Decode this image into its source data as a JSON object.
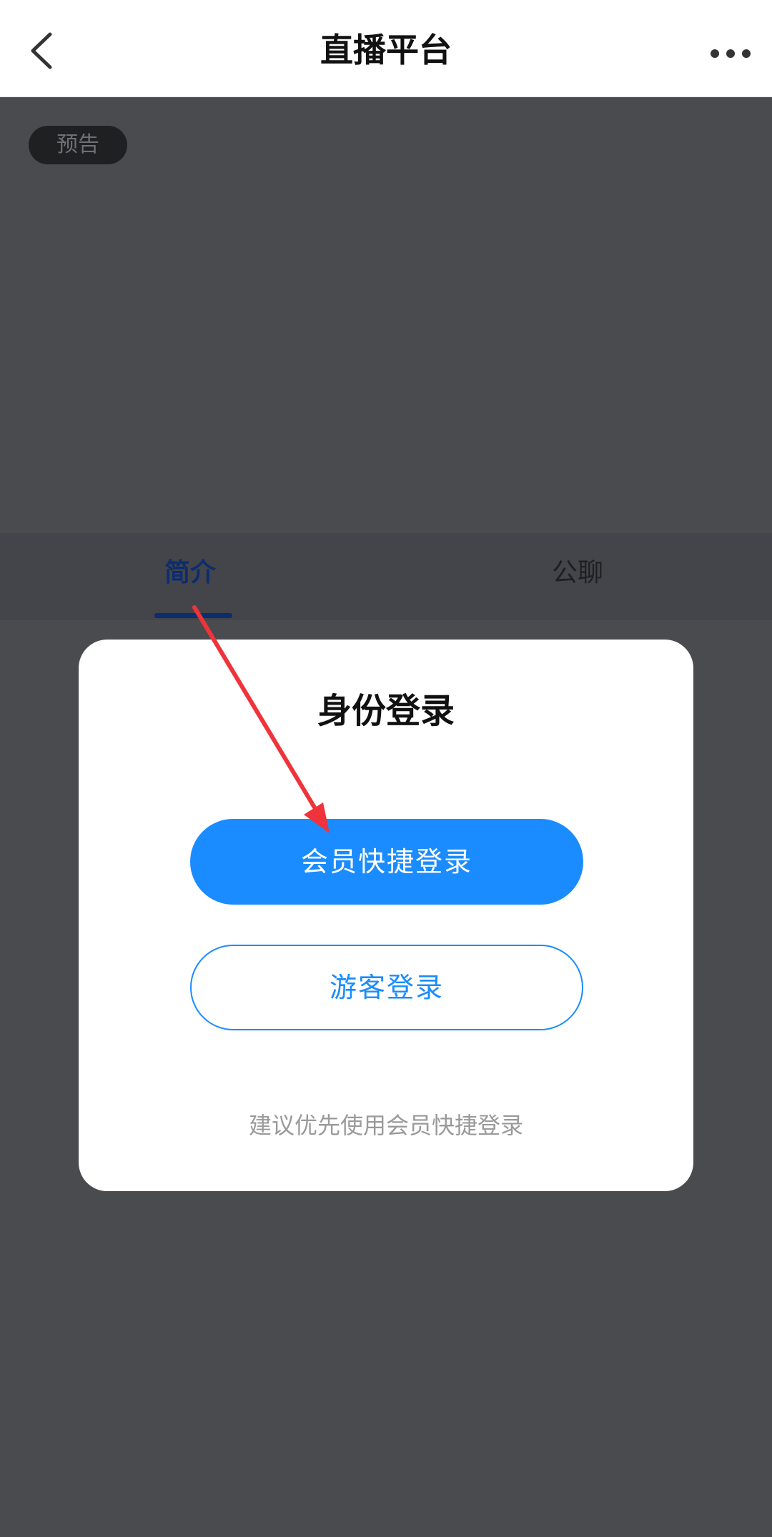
{
  "nav": {
    "title": "直播平台",
    "back_icon": "chevron-left-icon",
    "more_icon": "more-horizontal-icon"
  },
  "video": {
    "badge": "预告"
  },
  "tabs": [
    {
      "label": "简介",
      "active": true
    },
    {
      "label": "公聊",
      "active": false
    }
  ],
  "modal": {
    "title": "身份登录",
    "member_button": "会员快捷登录",
    "guest_button": "游客登录",
    "hint": "建议优先使用会员快捷登录"
  },
  "annotation": {
    "icon": "red-arrow-icon",
    "color": "#f0333a"
  },
  "colors": {
    "primary": "#1a8cff",
    "overlay": "#4a4b4f",
    "tab_active": "#0c2d6e"
  }
}
